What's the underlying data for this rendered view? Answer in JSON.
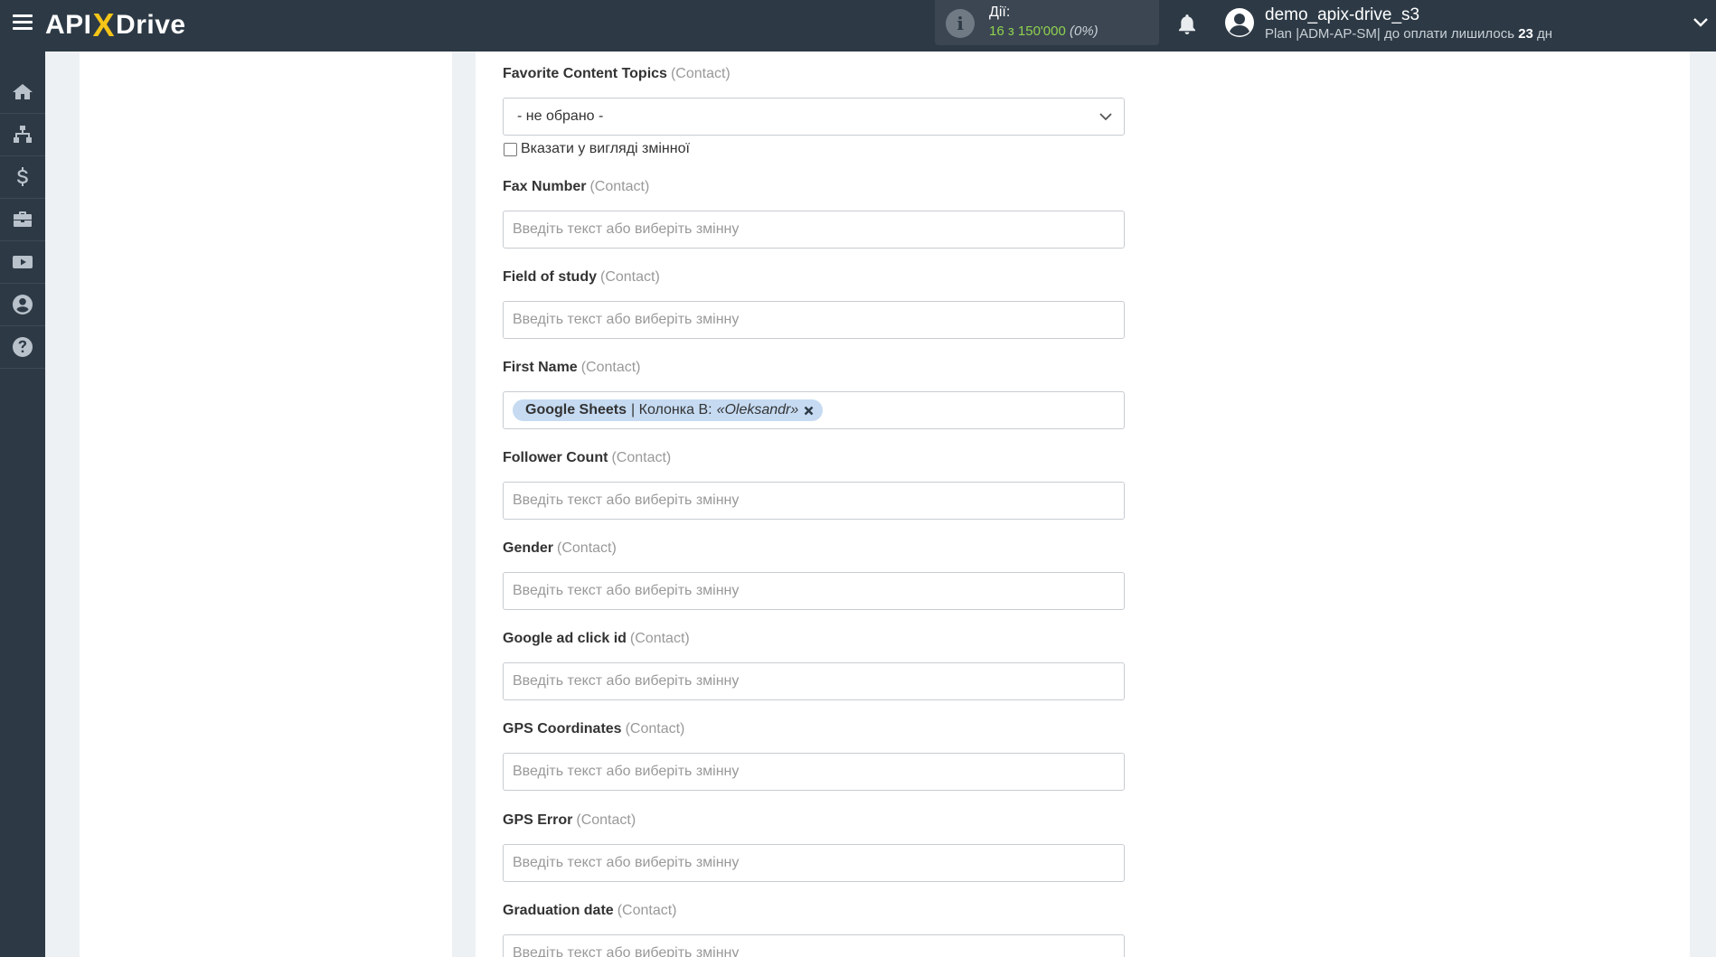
{
  "header": {
    "logo_left": "API",
    "logo_x": "X",
    "logo_right": "Drive",
    "actions_label": "Дії:",
    "actions_count": "16 з 150'000",
    "actions_pct": "(0%)",
    "user_name": "demo_apix-drive_s3",
    "plan_text": "Plan |ADM-AP-SM| до оплати лишилось",
    "plan_days": "23",
    "plan_days_unit": "дн"
  },
  "sidebar": {
    "items": [
      "home-icon",
      "sitemap-icon",
      "dollar-icon",
      "briefcase-icon",
      "youtube-icon",
      "user-icon",
      "help-icon"
    ]
  },
  "form": {
    "placeholder": "Введіть текст або виберіть змінну",
    "favorite": {
      "label": "Favorite Content Topics",
      "tag": "(Contact)",
      "selected": "- не обрано -",
      "checkbox_label": "Вказати у вигляді змінної"
    },
    "fields": [
      {
        "label": "Fax Number",
        "tag": "(Contact)"
      },
      {
        "label": "Field of study",
        "tag": "(Contact)"
      },
      {
        "label": "First Name",
        "tag": "(Contact)"
      },
      {
        "label": "Follower Count",
        "tag": "(Contact)"
      },
      {
        "label": "Gender",
        "tag": "(Contact)"
      },
      {
        "label": "Google ad click id",
        "tag": "(Contact)"
      },
      {
        "label": "GPS Coordinates",
        "tag": "(Contact)"
      },
      {
        "label": "GPS Error",
        "tag": "(Contact)"
      },
      {
        "label": "Graduation date",
        "tag": "(Contact)"
      }
    ],
    "first_name_chip": {
      "source": "Google Sheets",
      "column": "| Колонка B:",
      "value": "«Oleksandr»"
    }
  }
}
